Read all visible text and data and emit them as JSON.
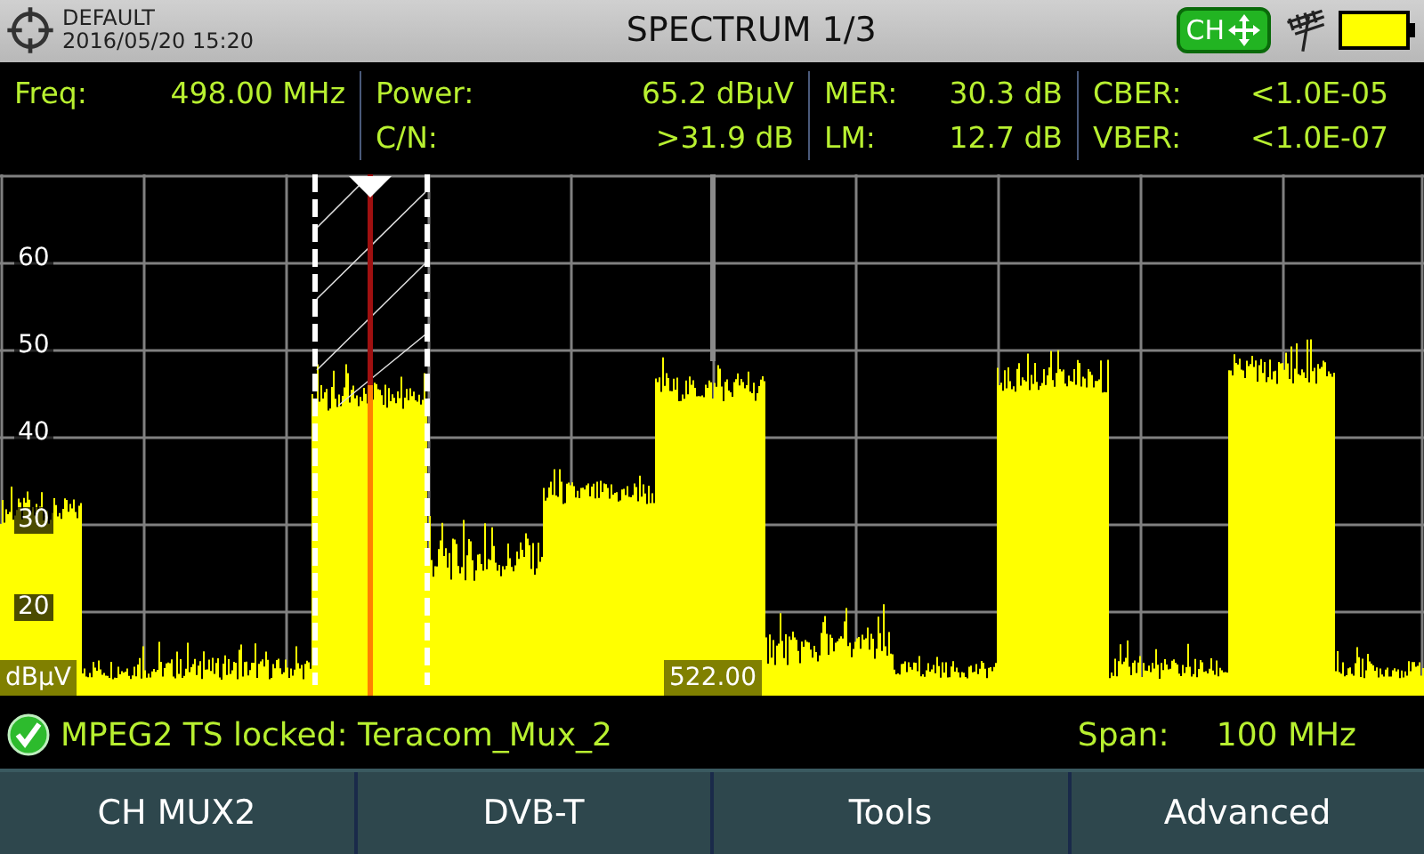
{
  "header": {
    "profile": "DEFAULT",
    "datetime": "2016/05/20 15:20",
    "title": "SPECTRUM 1/3",
    "mode_badge": "CH"
  },
  "measurements": [
    [
      {
        "label": "Freq:",
        "value": "498.00 MHz"
      }
    ],
    [
      {
        "label": "Power:",
        "value": "65.2 dBµV"
      },
      {
        "label": "C/N:",
        "value": ">31.9 dB"
      }
    ],
    [
      {
        "label": "MER:",
        "value": "30.3 dB"
      },
      {
        "label": "LM:",
        "value": "12.7 dB"
      }
    ],
    [
      {
        "label": "CBER:",
        "value": "<1.0E-05"
      },
      {
        "label": "VBER:",
        "value": "<1.0E-07"
      }
    ]
  ],
  "chart": {
    "unit_label": "dBµV",
    "y_tick_labels": [
      "60",
      "50",
      "40",
      "30",
      "20"
    ],
    "marker_label": "522.00"
  },
  "status": {
    "locked": true,
    "message": "MPEG2 TS locked: Teracom_Mux_2",
    "span_label": "Span:",
    "span_value": "100 MHz"
  },
  "softkeys": [
    "CH MUX2",
    "DVB-T",
    "Tools",
    "Advanced"
  ]
}
